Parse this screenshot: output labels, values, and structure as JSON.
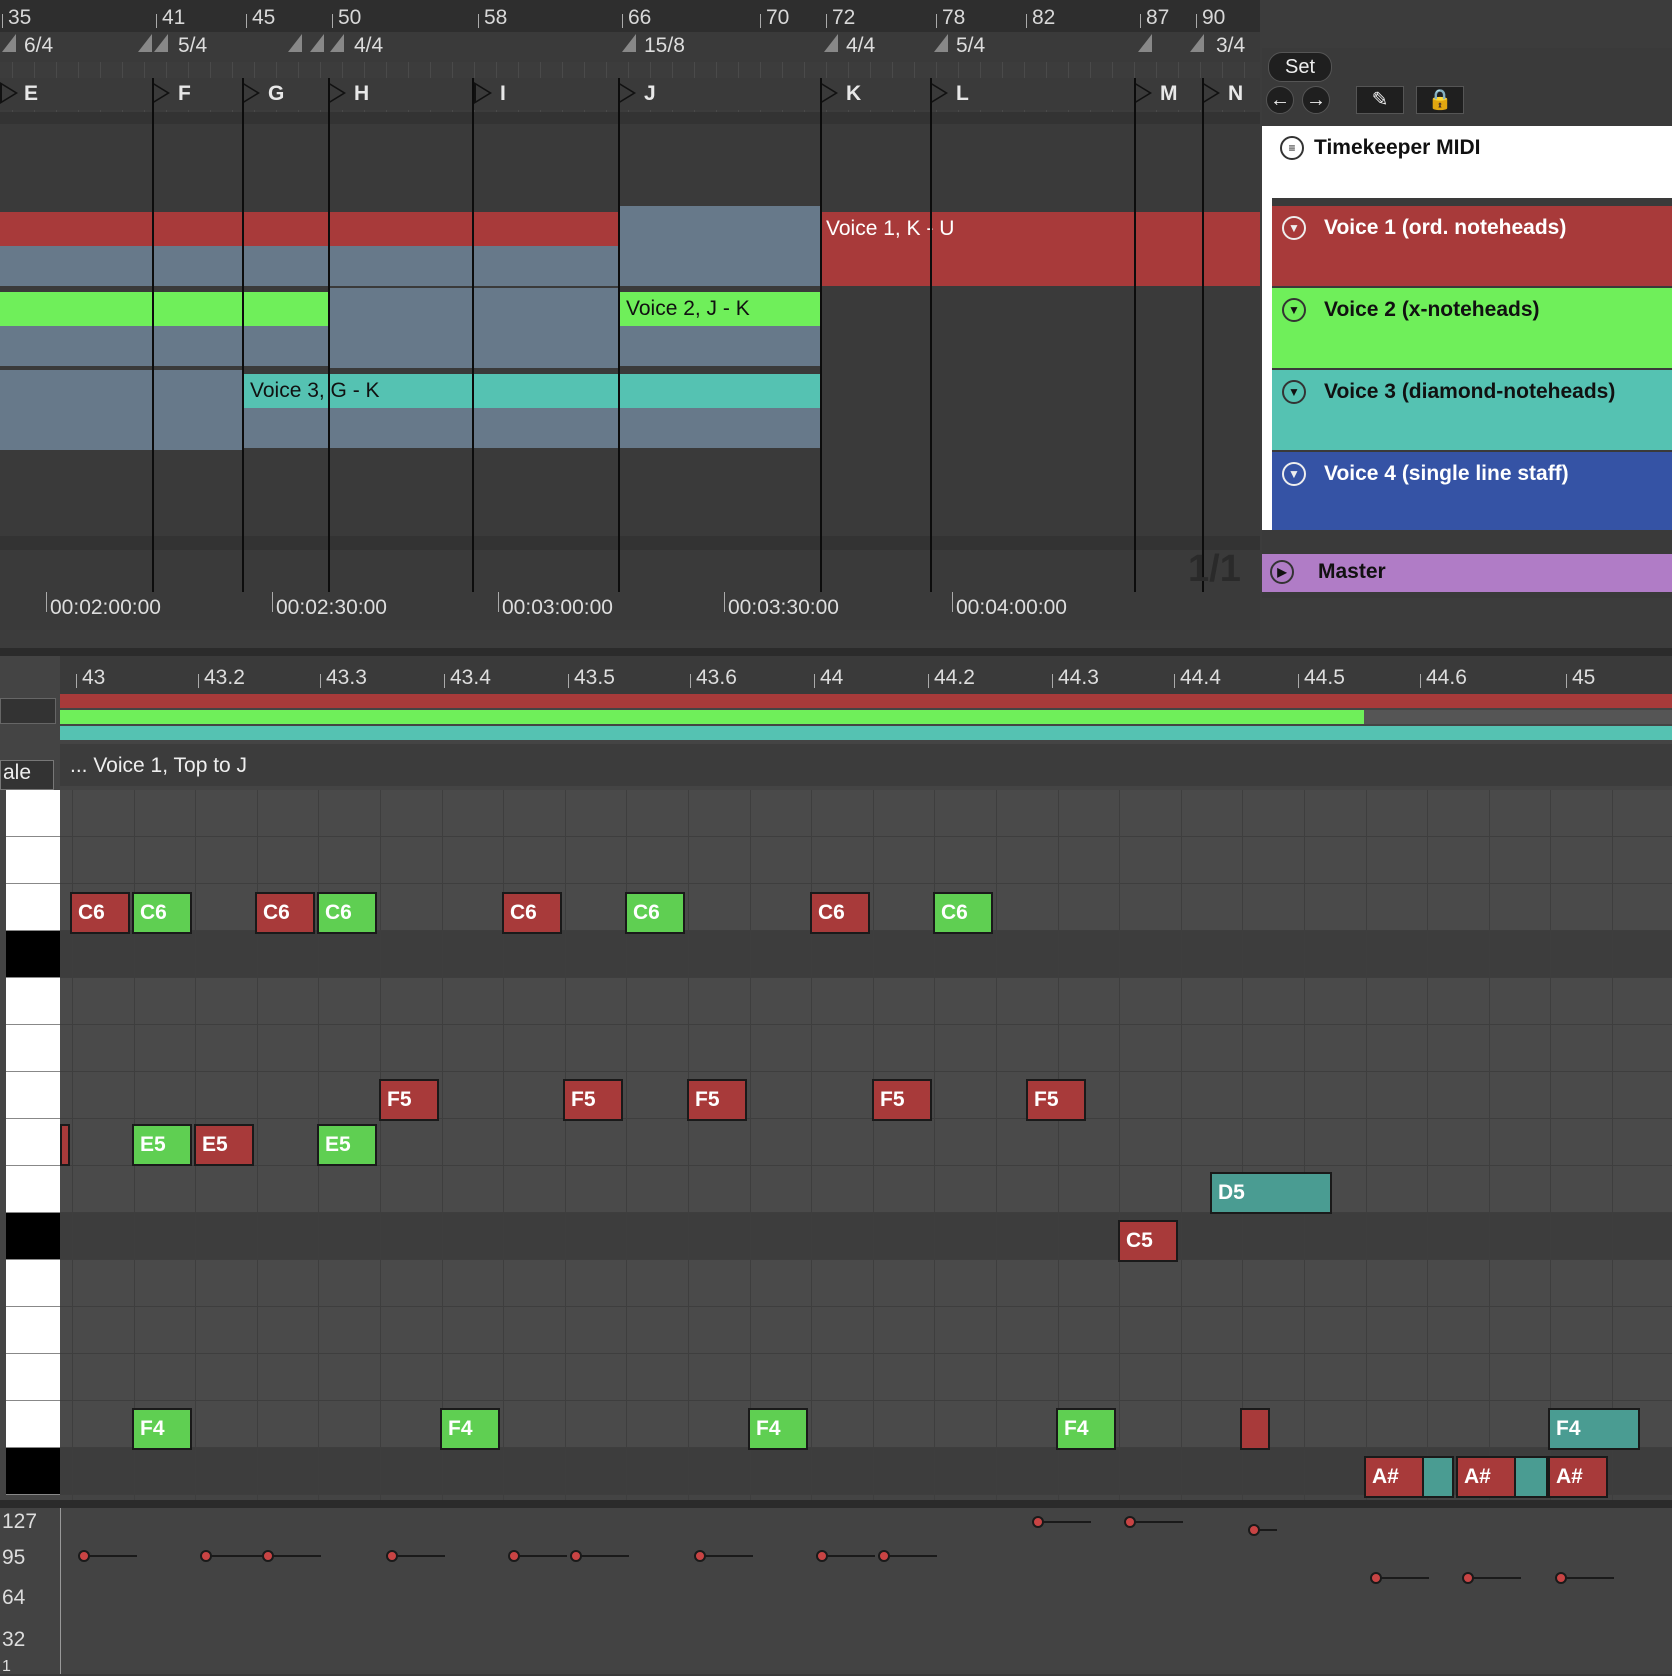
{
  "arrangement": {
    "bar_numbers": [
      "35",
      "41",
      "45",
      "50",
      "58",
      "66",
      "70",
      "72",
      "78",
      "82",
      "87",
      "90"
    ],
    "time_signatures": [
      "6/4",
      "5/4",
      "4/4",
      "15/8",
      "4/4",
      "5/4",
      "3/4"
    ],
    "locators": [
      "E",
      "F",
      "G",
      "H",
      "I",
      "J",
      "K",
      "L",
      "M",
      "N"
    ],
    "clips": {
      "voice1_clip_label": "Voice 1, K - U",
      "voice2_clip_label": "Voice 2, J - K",
      "voice3_clip_label": "Voice 3, G - K"
    },
    "time_ruler": [
      "00:02:00:00",
      "00:02:30:00",
      "00:03:00:00",
      "00:03:30:00",
      "00:04:00:00"
    ],
    "zoom_label": "1/1"
  },
  "panel": {
    "set_button": "Set",
    "back_icon": "arrow-left-icon",
    "forward_icon": "arrow-right-icon",
    "tracks": [
      {
        "name": "Timekeeper MIDI",
        "color": "#ffffff"
      },
      {
        "name": "Voice 1 (ord. noteheads)",
        "color": "#a83a3a"
      },
      {
        "name": "Voice 2 (x-noteheads)",
        "color": "#6fef5a"
      },
      {
        "name": "Voice 3 (diamond-noteheads)",
        "color": "#55c2b2"
      },
      {
        "name": "Voice 4 (single line staff)",
        "color": "#3553a5"
      },
      {
        "name": "Master",
        "color": "#b07cc6"
      }
    ]
  },
  "piano_roll": {
    "ruler": [
      "43",
      "43.2",
      "43.3",
      "43.4",
      "43.5",
      "43.6",
      "44",
      "44.2",
      "44.3",
      "44.4",
      "44.5",
      "44.6",
      "45"
    ],
    "scale_label": "ale",
    "clip_title": "... Voice 1, Top to J",
    "notes": [
      {
        "pitch": "C6",
        "voice": "red"
      },
      {
        "pitch": "C6",
        "voice": "green"
      },
      {
        "pitch": "C6",
        "voice": "red"
      },
      {
        "pitch": "C6",
        "voice": "green"
      },
      {
        "pitch": "C6",
        "voice": "red"
      },
      {
        "pitch": "C6",
        "voice": "green"
      },
      {
        "pitch": "C6",
        "voice": "red"
      },
      {
        "pitch": "C6",
        "voice": "green"
      },
      {
        "pitch": "F5",
        "voice": "red"
      },
      {
        "pitch": "F5",
        "voice": "red"
      },
      {
        "pitch": "F5",
        "voice": "red"
      },
      {
        "pitch": "F5",
        "voice": "red"
      },
      {
        "pitch": "F5",
        "voice": "red"
      },
      {
        "pitch": "E5",
        "voice": "green"
      },
      {
        "pitch": "E5",
        "voice": "red"
      },
      {
        "pitch": "E5",
        "voice": "green"
      },
      {
        "pitch": "D5",
        "voice": "teal"
      },
      {
        "pitch": "C5",
        "voice": "red"
      },
      {
        "pitch": "F4",
        "voice": "green"
      },
      {
        "pitch": "F4",
        "voice": "green"
      },
      {
        "pitch": "F4",
        "voice": "green"
      },
      {
        "pitch": "F4",
        "voice": "green"
      },
      {
        "pitch": "F4",
        "voice": "teal"
      },
      {
        "pitch": "A#",
        "voice": "red"
      },
      {
        "pitch": "A#",
        "voice": "red"
      },
      {
        "pitch": "A#",
        "voice": "red"
      }
    ],
    "velocity_axis": [
      "127",
      "95",
      "64",
      "32",
      "1"
    ]
  }
}
